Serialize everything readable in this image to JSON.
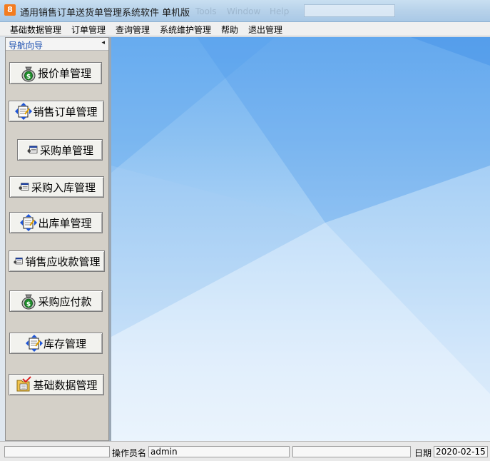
{
  "window": {
    "title": "通用销售订单送货单管理系统软件  单机版",
    "icon_text": "8",
    "ghost_menu": [
      "Tools",
      "Window",
      "Help"
    ]
  },
  "menu": {
    "items": [
      "基础数据管理",
      "订单管理",
      "查询管理",
      "系统维护管理",
      "帮助",
      "退出管理"
    ]
  },
  "nav": {
    "title": "导航向导",
    "collapse_glyph": "◂",
    "buttons": [
      {
        "label": "报价单管理",
        "icon": "money-bag-icon"
      },
      {
        "label": "销售订单管理",
        "icon": "notebook-arrows-icon"
      },
      {
        "label": "采购单管理",
        "icon": "form-icon"
      },
      {
        "label": "采购入库管理",
        "icon": "form-icon"
      },
      {
        "label": "出库单管理",
        "icon": "notebook-arrows-icon"
      },
      {
        "label": "销售应收款管理",
        "icon": "form-icon"
      },
      {
        "label": "采购应付款",
        "icon": "money-bag-icon"
      },
      {
        "label": "库存管理",
        "icon": "notebook-arrows-icon"
      },
      {
        "label": "基础数据管理",
        "icon": "folder-check-icon"
      }
    ]
  },
  "status": {
    "operator_label": "操作员名",
    "operator_value": "admin",
    "date_label": "日期",
    "date_value": "2020-02-15"
  },
  "colors": {
    "nav_title": "#1c4fb0",
    "app_icon": "#f37c20",
    "workspace_top": "#6fb0f0"
  }
}
